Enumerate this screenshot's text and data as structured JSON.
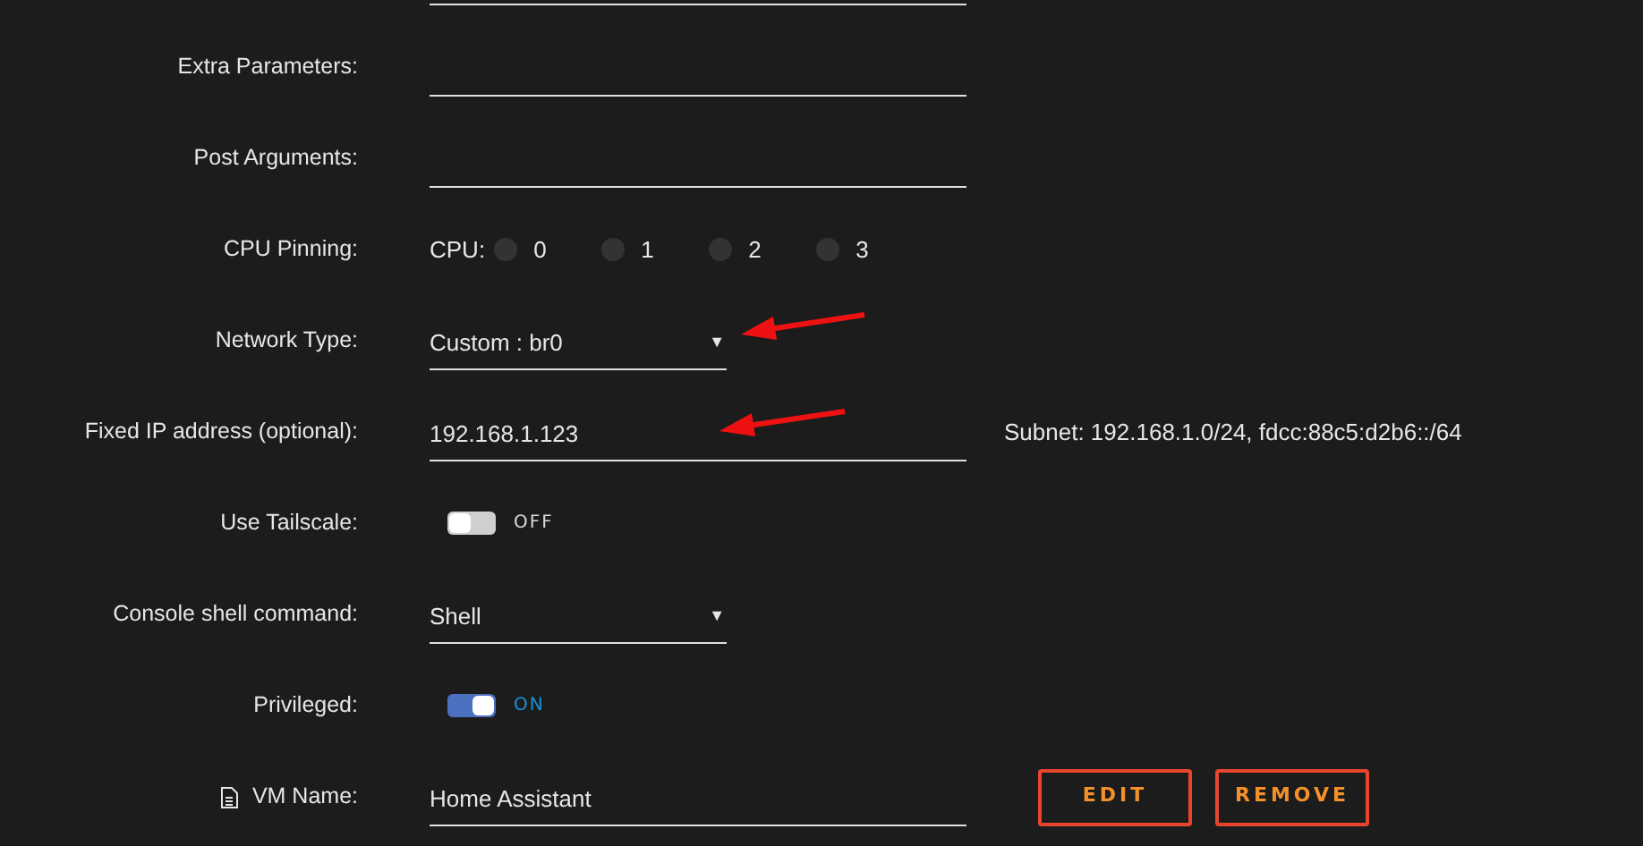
{
  "rows": [
    {
      "kind": "text",
      "label": "",
      "value": ""
    },
    {
      "kind": "text",
      "label": "Extra Parameters:",
      "value": ""
    },
    {
      "kind": "text",
      "label": "Post Arguments:",
      "value": ""
    },
    {
      "kind": "cpu",
      "label": "CPU Pinning:",
      "prefix": "CPU:",
      "cpus": [
        {
          "label": "0",
          "selected": false
        },
        {
          "label": "1",
          "selected": false
        },
        {
          "label": "2",
          "selected": false
        },
        {
          "label": "3",
          "selected": false
        }
      ]
    },
    {
      "kind": "select",
      "label": "Network Type:",
      "value": "Custom : br0",
      "caret": "▼"
    },
    {
      "kind": "text",
      "label": "Fixed IP address (optional):",
      "value": "192.168.1.123",
      "note": "Subnet: 192.168.1.0/24, fdcc:88c5:d2b6::/64"
    },
    {
      "kind": "toggle",
      "label": "Use Tailscale:",
      "on": false,
      "state_text": "OFF"
    },
    {
      "kind": "select",
      "label": "Console shell command:",
      "value": "Shell",
      "caret": "▼"
    },
    {
      "kind": "toggle",
      "label": "Privileged:",
      "on": true,
      "state_text": "ON"
    },
    {
      "kind": "name",
      "label": "VM Name:",
      "value": "Home Assistant",
      "buttons": [
        "EDIT",
        "REMOVE"
      ]
    }
  ]
}
